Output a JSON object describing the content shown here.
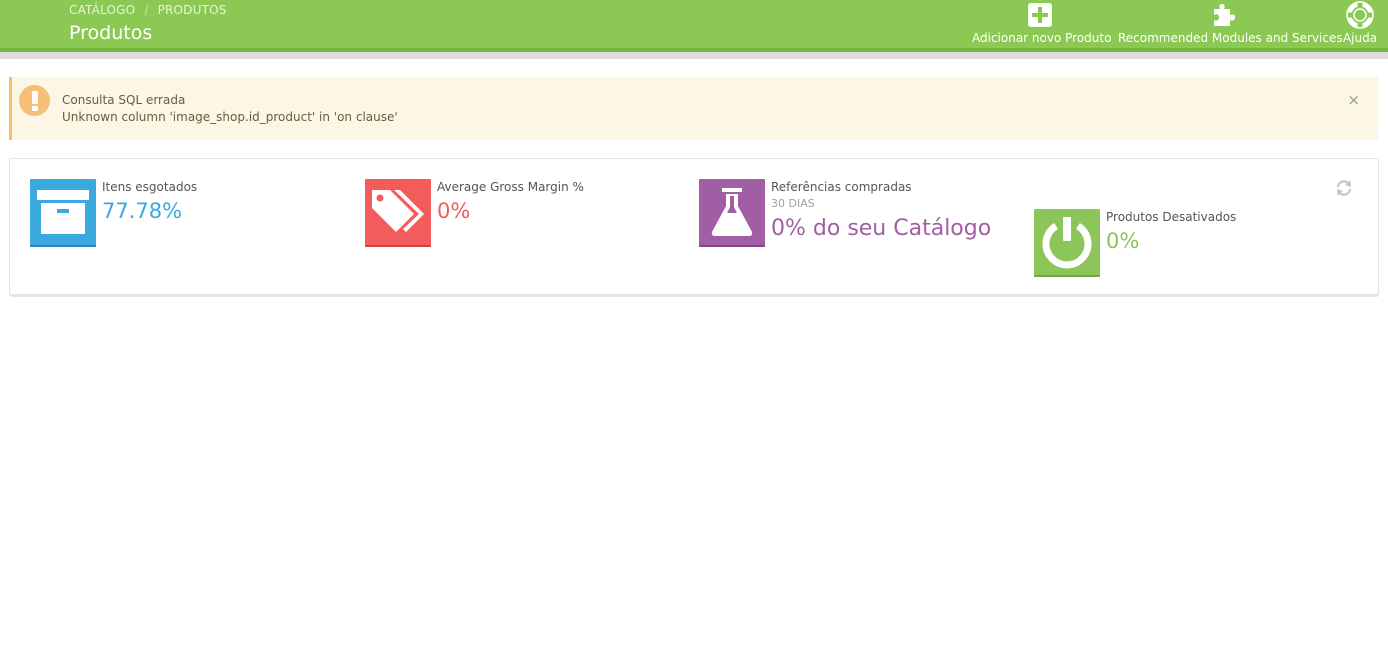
{
  "breadcrumb": {
    "parent": "CATÁLOGO",
    "separator": "/",
    "current": "PRODUTOS"
  },
  "page": {
    "title": "Produtos"
  },
  "toolbar": {
    "add_product": "Adicionar novo Produto",
    "recommended": "Recommended Modules and Services",
    "help": "Ajuda"
  },
  "alert": {
    "title": "Consulta SQL errada",
    "message": "Unknown column 'image_shop.id_product' in 'on clause'",
    "close": "×"
  },
  "kpis": [
    {
      "title": "Itens esgotados",
      "value": "77.78%",
      "color": "#3aa9de",
      "icon": "archive-icon"
    },
    {
      "title": "Average Gross Margin %",
      "value": "0%",
      "color": "#f45c5c",
      "icon": "tags-icon"
    },
    {
      "title": "Referências compradas",
      "subtitle": "30 DIAS",
      "value": "0% do seu Catálogo",
      "color": "#a15ea5",
      "icon": "flask-icon"
    },
    {
      "title": "Produtos Desativados",
      "value": "0%",
      "color": "#8cc55a",
      "icon": "power-off-icon"
    }
  ],
  "colors": {
    "toolbar": "#8bc954",
    "alert_bg": "#fcf6e5",
    "alert_accent": "#f5bf77"
  }
}
